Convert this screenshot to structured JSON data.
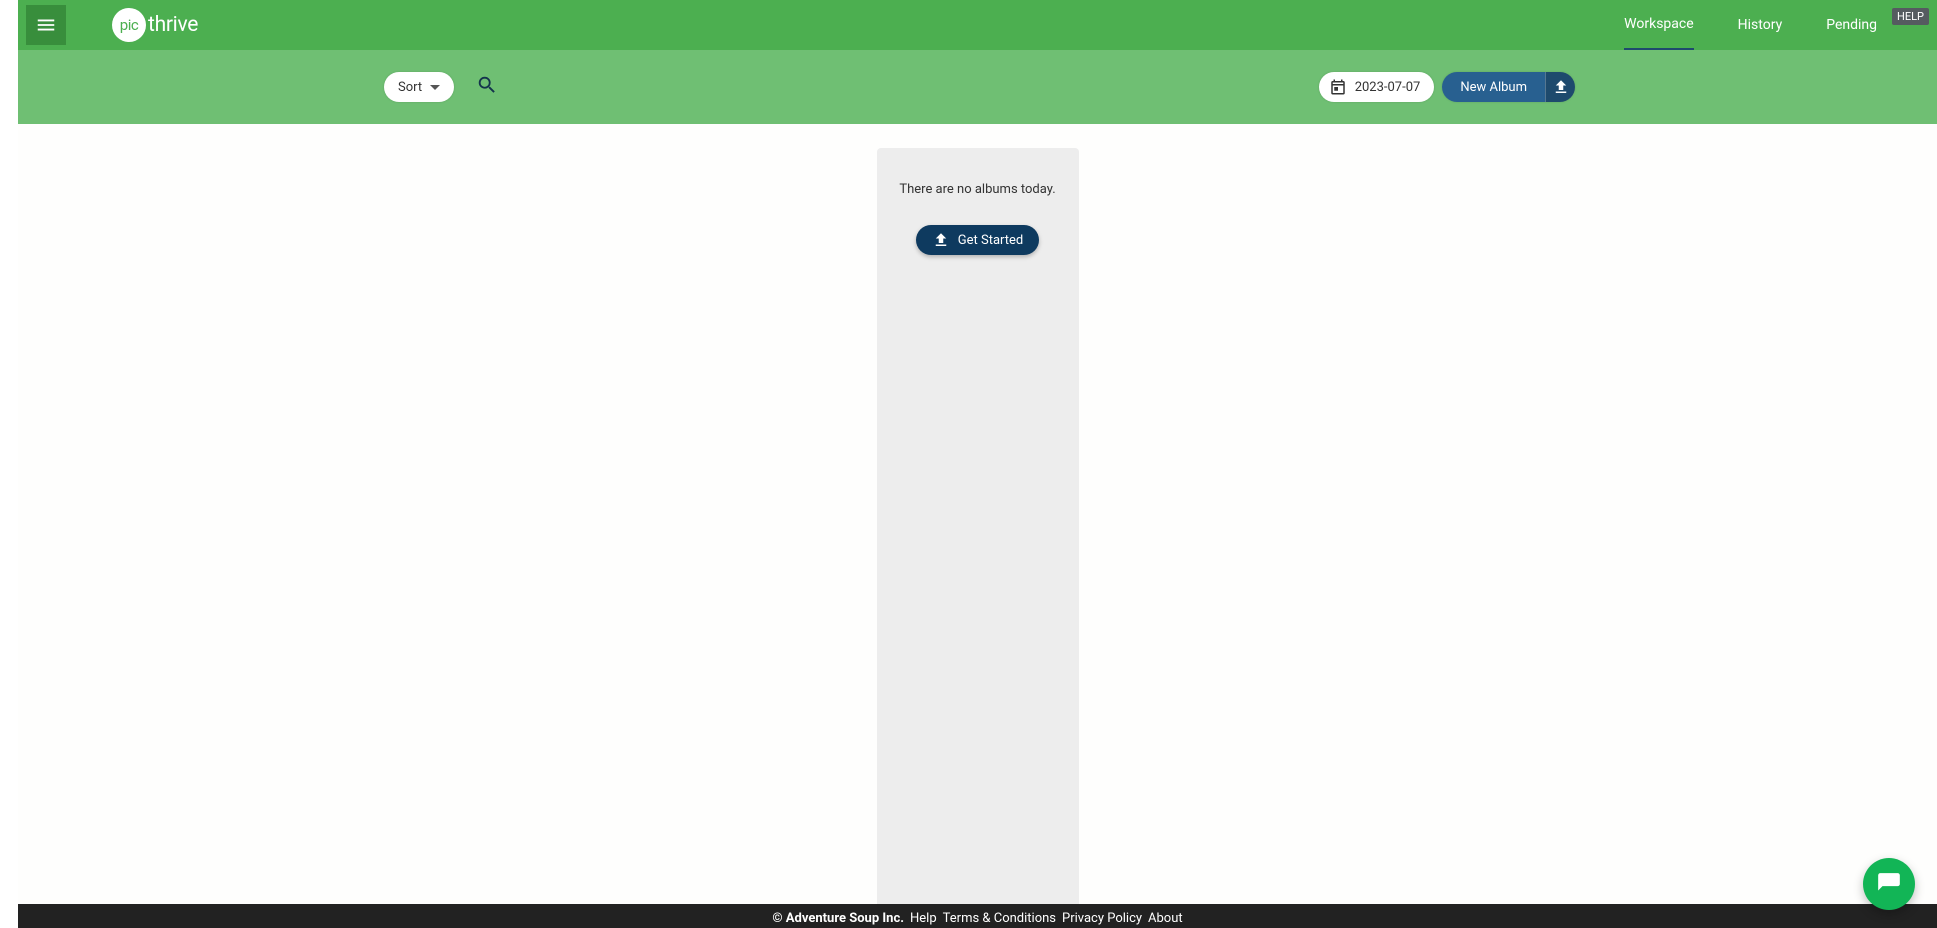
{
  "logo": {
    "circle_text": "pic",
    "rest_text": "thrive"
  },
  "nav": {
    "tabs": [
      {
        "label": "Workspace",
        "active": true
      },
      {
        "label": "History",
        "active": false
      },
      {
        "label": "Pending",
        "active": false
      }
    ],
    "help_label": "HELP"
  },
  "toolbar": {
    "sort_label": "Sort",
    "date_value": "2023-07-07",
    "new_album_label": "New Album"
  },
  "empty_state": {
    "message": "There are no albums today.",
    "cta_label": "Get Started"
  },
  "footer": {
    "copyright": "© Adventure Soup Inc.",
    "links": [
      "Help",
      "Terms & Conditions",
      "Privacy Policy",
      "About"
    ]
  }
}
